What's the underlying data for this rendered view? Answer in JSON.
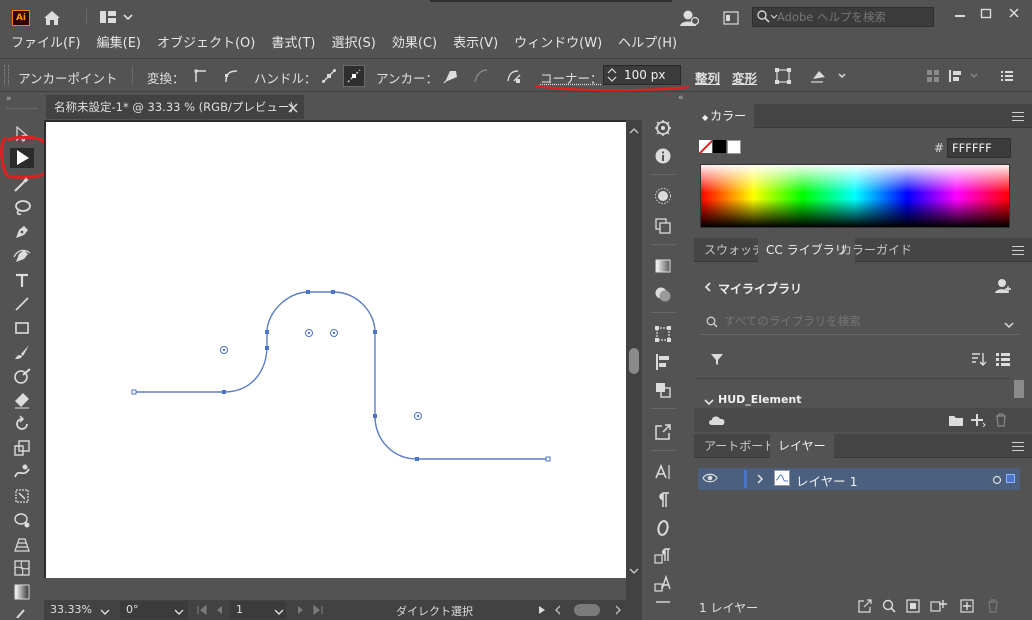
{
  "app": {
    "logo": "Ai"
  },
  "titlebar": {
    "help_search_placeholder": "Adobe ヘルプを検索"
  },
  "menu": [
    "ファイル(F)",
    "編集(E)",
    "オブジェクト(O)",
    "書式(T)",
    "選択(S)",
    "効果(C)",
    "表示(V)",
    "ウィンドウ(W)",
    "ヘルプ(H)"
  ],
  "control": {
    "context": "アンカーポイント",
    "convert_label": "変換：",
    "handle_label": "ハンドル：",
    "anchor_label": "アンカー：",
    "corner_label": "コーナー：",
    "corner_value": "100 px",
    "align_label": "整列",
    "transform_label": "変形"
  },
  "document": {
    "tab_title": "名称未設定-1* @ 33.33 % (RGB/プレビュー)"
  },
  "status": {
    "zoom": "33.33%",
    "rotation": "0°",
    "artboard_index": "1",
    "tool_name": "ダイレクト選択"
  },
  "color_panel": {
    "title": "カラー",
    "hex_label": "#",
    "hex_value": "FFFFFF"
  },
  "library_panel": {
    "tabs": [
      "スウォッチ",
      "CC ライブラリ",
      "カラーガイド"
    ],
    "my_library": "マイライブラリ",
    "search_placeholder": "すべてのライブラリを検索",
    "group_name": "HUD_Element"
  },
  "layers_panel": {
    "tabs": [
      "アートボード",
      "レイヤー"
    ],
    "layer_name": "レイヤー 1",
    "layer_count": "1 レイヤー"
  },
  "colors": {
    "accent_blue": "#4c74c9",
    "path_blue": "#5b7fc4",
    "annotation_red": "#e02020",
    "layer_row": "#4b5f7e"
  }
}
